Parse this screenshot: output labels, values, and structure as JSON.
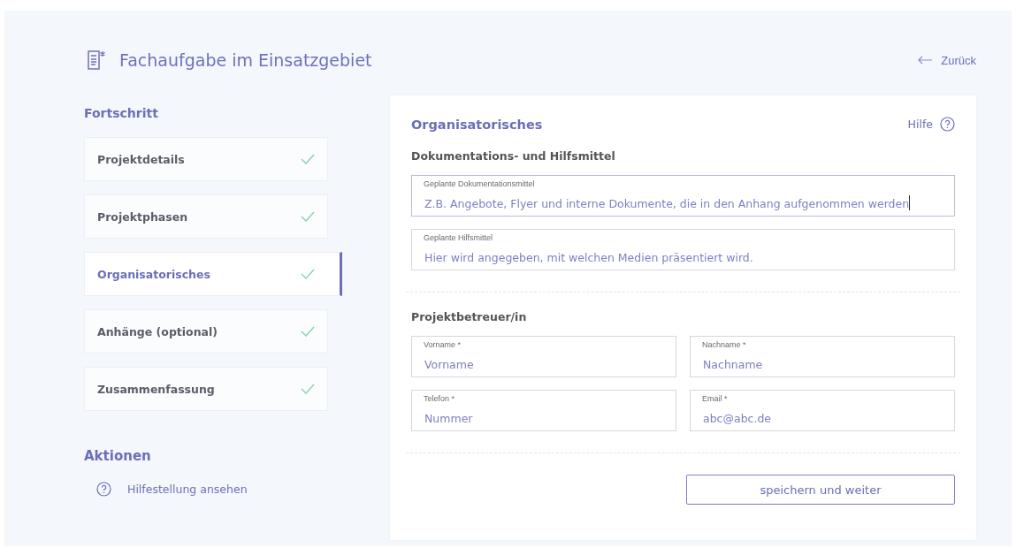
{
  "header": {
    "title": "Fachaufgabe im Einsatzgebiet",
    "back_link": "Zurück"
  },
  "sidebar": {
    "progress_heading": "Fortschritt",
    "steps": [
      {
        "label": "Projektdetails",
        "done": true,
        "selected": false
      },
      {
        "label": "Projektphasen",
        "done": true,
        "selected": false
      },
      {
        "label": "Organisatorisches",
        "done": true,
        "selected": true
      },
      {
        "label": "Anhänge (optional)",
        "done": true,
        "selected": false
      },
      {
        "label": "Zusammenfassung",
        "done": true,
        "selected": false
      }
    ],
    "actions_heading": "Aktionen",
    "actions": [
      {
        "label": "Hilfestellung ansehen"
      }
    ]
  },
  "form": {
    "title": "Organisatorisches",
    "help_link": "Hilfe",
    "sections": [
      {
        "heading": "Dokumentations- und Hilfsmittel",
        "fields": [
          {
            "label": "Geplante Dokumentationsmittel",
            "placeholder": "Z.B. Angebote, Flyer und interne Dokumente, die in den Anhang aufgenommen werden",
            "focused": true
          },
          {
            "label": "Geplante Hilfsmittel",
            "placeholder": "Hier wird angegeben, mit welchen Medien präsentiert wird.",
            "focused": false
          }
        ]
      },
      {
        "heading": "Projektbetreuer/in",
        "fields": [
          {
            "label": "Vorname *",
            "placeholder": "Vorname",
            "focused": false
          },
          {
            "label": "Nachname *",
            "placeholder": "Nachname",
            "focused": false
          },
          {
            "label": "Telefon *",
            "placeholder": "Nummer",
            "focused": false
          },
          {
            "label": "Email *",
            "placeholder": "abc@abc.de",
            "focused": false
          }
        ]
      }
    ],
    "submit_button": "speichern und weiter"
  }
}
